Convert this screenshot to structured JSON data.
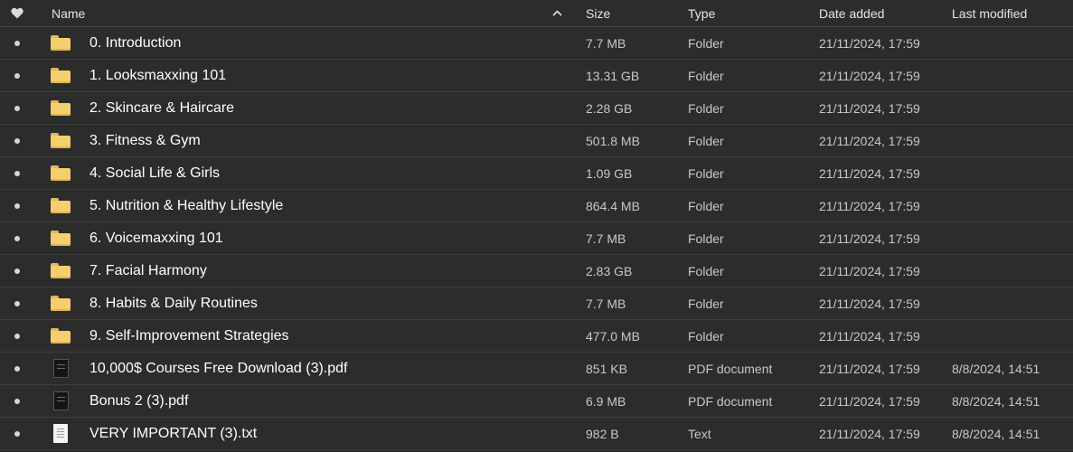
{
  "header": {
    "favorite_icon": "heart-icon",
    "name": "Name",
    "sort_icon": "chevron-up-icon",
    "size": "Size",
    "type": "Type",
    "date_added": "Date added",
    "last_modified": "Last modified"
  },
  "rows": [
    {
      "name": "0. Introduction",
      "size": "7.7 MB",
      "type": "Folder",
      "date_added": "21/11/2024, 17:59",
      "last_modified": "",
      "icon": "folder-icon"
    },
    {
      "name": "1. Looksmaxxing 101",
      "size": "13.31 GB",
      "type": "Folder",
      "date_added": "21/11/2024, 17:59",
      "last_modified": "",
      "icon": "folder-icon"
    },
    {
      "name": "2. Skincare & Haircare",
      "size": "2.28 GB",
      "type": "Folder",
      "date_added": "21/11/2024, 17:59",
      "last_modified": "",
      "icon": "folder-icon"
    },
    {
      "name": "3. Fitness & Gym",
      "size": "501.8 MB",
      "type": "Folder",
      "date_added": "21/11/2024, 17:59",
      "last_modified": "",
      "icon": "folder-icon"
    },
    {
      "name": "4. Social Life & Girls",
      "size": "1.09 GB",
      "type": "Folder",
      "date_added": "21/11/2024, 17:59",
      "last_modified": "",
      "icon": "folder-icon"
    },
    {
      "name": "5. Nutrition & Healthy Lifestyle",
      "size": "864.4 MB",
      "type": "Folder",
      "date_added": "21/11/2024, 17:59",
      "last_modified": "",
      "icon": "folder-icon"
    },
    {
      "name": "6. Voicemaxxing 101",
      "size": "7.7 MB",
      "type": "Folder",
      "date_added": "21/11/2024, 17:59",
      "last_modified": "",
      "icon": "folder-icon"
    },
    {
      "name": "7. Facial Harmony",
      "size": "2.83 GB",
      "type": "Folder",
      "date_added": "21/11/2024, 17:59",
      "last_modified": "",
      "icon": "folder-icon"
    },
    {
      "name": "8. Habits & Daily Routines",
      "size": "7.7 MB",
      "type": "Folder",
      "date_added": "21/11/2024, 17:59",
      "last_modified": "",
      "icon": "folder-icon"
    },
    {
      "name": "9. Self-Improvement Strategies",
      "size": "477.0 MB",
      "type": "Folder",
      "date_added": "21/11/2024, 17:59",
      "last_modified": "",
      "icon": "folder-icon"
    },
    {
      "name": "10,000$ Courses Free Download (3).pdf",
      "size": "851 KB",
      "type": "PDF document",
      "date_added": "21/11/2024, 17:59",
      "last_modified": "8/8/2024, 14:51",
      "icon": "pdf-file-icon"
    },
    {
      "name": "Bonus 2 (3).pdf",
      "size": "6.9 MB",
      "type": "PDF document",
      "date_added": "21/11/2024, 17:59",
      "last_modified": "8/8/2024, 14:51",
      "icon": "pdf-file-icon"
    },
    {
      "name": "VERY IMPORTANT (3).txt",
      "size": "982 B",
      "type": "Text",
      "date_added": "21/11/2024, 17:59",
      "last_modified": "8/8/2024, 14:51",
      "icon": "text-file-icon"
    }
  ],
  "colors": {
    "background": "#2c2c2c",
    "folder": "#f5cf6e",
    "row_border": "#3e3e3e"
  }
}
